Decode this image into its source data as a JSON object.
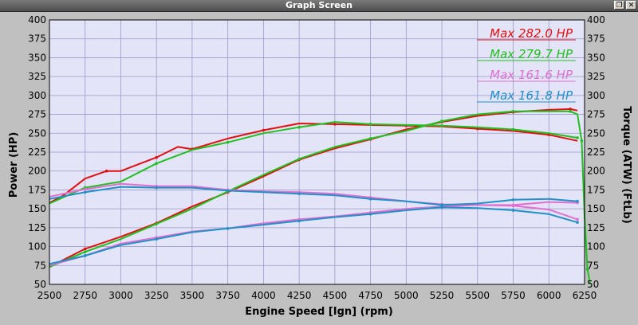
{
  "window": {
    "title": "Graph Screen"
  },
  "window_buttons": [
    {
      "name": "restore-button",
      "glyph": "❐"
    },
    {
      "name": "close-button",
      "glyph": "✕"
    }
  ],
  "chart_data": {
    "type": "line",
    "title": "",
    "xlabel": "Engine Speed [Ign] (rpm)",
    "ylabel": "Power (HP)",
    "ylabel_right": "Torque (ATW) (FtLb)",
    "xlim": [
      2500,
      6250
    ],
    "ylim": [
      50,
      400
    ],
    "ylim_right": [
      50,
      400
    ],
    "x_ticks": [
      "2500",
      "2750",
      "3000",
      "3250",
      "3500",
      "3750",
      "4000",
      "4250",
      "4500",
      "4750",
      "5000",
      "5250",
      "5500",
      "5750",
      "6000",
      "6250"
    ],
    "y_ticks": [
      "400",
      "375",
      "350",
      "325",
      "300",
      "275",
      "250",
      "225",
      "200",
      "175",
      "150",
      "125",
      "100",
      "75",
      "50"
    ],
    "y_ticks_right": [
      "400",
      "375",
      "350",
      "325",
      "300",
      "275",
      "250",
      "225",
      "200",
      "175",
      "150",
      "125",
      "100",
      "75",
      "50"
    ],
    "grid": true,
    "background": "#e4e4f8",
    "legend_position": "top-right",
    "legend": [
      {
        "label": "Max 282.0 HP",
        "color": "#e01010"
      },
      {
        "label": "Max 279.7 HP",
        "color": "#20c020"
      },
      {
        "label": "Max 161.6 HP",
        "color": "#e070d0"
      },
      {
        "label": "Max 161.8 HP",
        "color": "#2090c8"
      }
    ],
    "series": [
      {
        "name": "Max 282.0 HP",
        "kind": "power",
        "color": "#e01010",
        "x": [
          2500,
          2750,
          3000,
          3250,
          3500,
          3750,
          4000,
          4250,
          4500,
          4750,
          5000,
          5250,
          5500,
          5750,
          6000,
          6150,
          6200
        ],
        "y": [
          73,
          97,
          113,
          131,
          153,
          172,
          193,
          215,
          230,
          242,
          255,
          265,
          273,
          278,
          281,
          282,
          280
        ]
      },
      {
        "name": "Max 282.0 HP",
        "kind": "torque",
        "color": "#e01010",
        "x": [
          2500,
          2600,
          2750,
          2900,
          3000,
          3250,
          3400,
          3500,
          3750,
          4000,
          4250,
          4500,
          4750,
          5000,
          5250,
          5500,
          5750,
          6000,
          6200
        ],
        "y": [
          158,
          168,
          190,
          200,
          200,
          218,
          232,
          229,
          243,
          254,
          263,
          262,
          261,
          260,
          259,
          256,
          253,
          248,
          240
        ]
      },
      {
        "name": "Max 279.7 HP",
        "kind": "power",
        "color": "#20c020",
        "x": [
          2500,
          2750,
          3000,
          3250,
          3500,
          3750,
          4000,
          4250,
          4500,
          4750,
          5000,
          5250,
          5500,
          5750,
          6000,
          6150,
          6200,
          6230,
          6250,
          6270,
          6290
        ],
        "y": [
          73,
          93,
          110,
          130,
          150,
          173,
          195,
          216,
          232,
          243,
          253,
          266,
          275,
          279,
          279,
          279,
          275,
          240,
          140,
          70,
          50
        ]
      },
      {
        "name": "Max 279.7 HP",
        "kind": "torque",
        "color": "#20c020",
        "x": [
          2500,
          2750,
          3000,
          3250,
          3500,
          3750,
          4000,
          4250,
          4500,
          4750,
          5000,
          5250,
          5500,
          5750,
          6000,
          6200
        ],
        "y": [
          157,
          178,
          186,
          210,
          228,
          238,
          250,
          258,
          265,
          262,
          261,
          260,
          258,
          255,
          250,
          244
        ]
      },
      {
        "name": "Max 161.6 HP",
        "kind": "power",
        "color": "#e070d0",
        "x": [
          2500,
          2750,
          3000,
          3250,
          3500,
          3750,
          4000,
          4250,
          4500,
          4750,
          5000,
          5250,
          5500,
          5750,
          6000,
          6200
        ],
        "y": [
          75,
          88,
          104,
          112,
          120,
          124,
          131,
          136,
          140,
          145,
          150,
          153,
          155,
          154,
          149,
          136
        ]
      },
      {
        "name": "Max 161.6 HP",
        "kind": "torque",
        "color": "#e070d0",
        "x": [
          2500,
          2750,
          3000,
          3250,
          3500,
          3750,
          4000,
          4250,
          4500,
          4750,
          5000,
          5250,
          5500,
          5750,
          6000,
          6200
        ],
        "y": [
          166,
          176,
          183,
          180,
          180,
          175,
          173,
          172,
          170,
          165,
          160,
          156,
          155,
          155,
          159,
          158
        ]
      },
      {
        "name": "Max 161.8 HP",
        "kind": "power",
        "color": "#2090c8",
        "x": [
          2500,
          2750,
          3000,
          3250,
          3500,
          3750,
          4000,
          4250,
          4500,
          4750,
          5000,
          5250,
          5500,
          5750,
          6000,
          6200
        ],
        "y": [
          77,
          88,
          102,
          110,
          119,
          124,
          129,
          134,
          139,
          143,
          148,
          152,
          151,
          148,
          143,
          132
        ]
      },
      {
        "name": "Max 161.8 HP",
        "kind": "torque",
        "color": "#2090c8",
        "x": [
          2500,
          2750,
          3000,
          3250,
          3500,
          3750,
          4000,
          4250,
          4500,
          4750,
          5000,
          5250,
          5500,
          5750,
          6000,
          6200
        ],
        "y": [
          163,
          172,
          179,
          178,
          178,
          174,
          172,
          170,
          168,
          163,
          160,
          155,
          157,
          162,
          163,
          160
        ]
      }
    ]
  }
}
